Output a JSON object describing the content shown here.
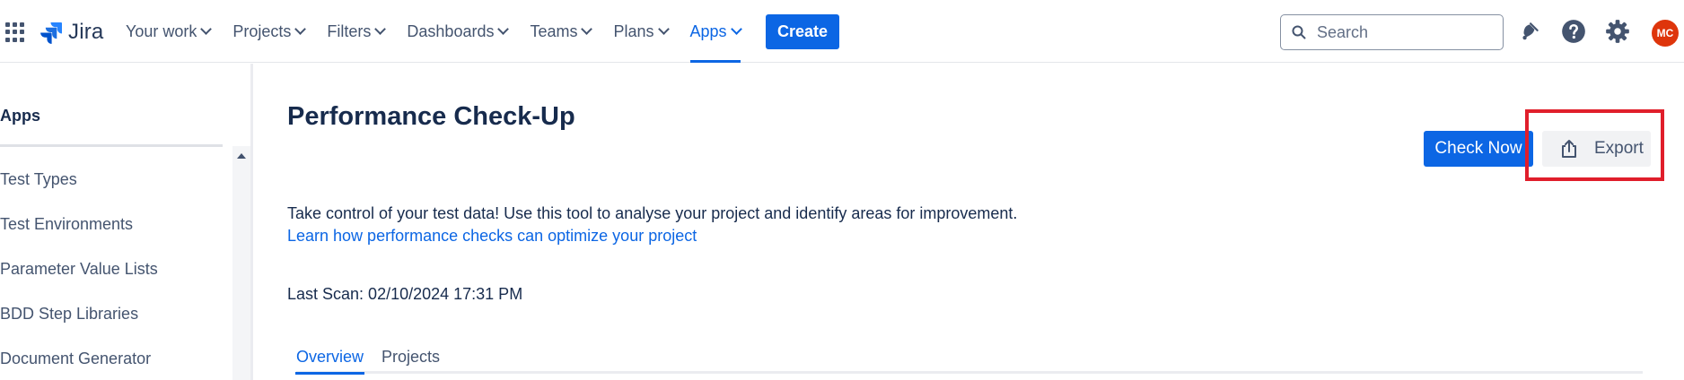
{
  "nav": {
    "logo_text": "Jira",
    "items": [
      {
        "label": "Your work"
      },
      {
        "label": "Projects"
      },
      {
        "label": "Filters"
      },
      {
        "label": "Dashboards"
      },
      {
        "label": "Teams"
      },
      {
        "label": "Plans"
      },
      {
        "label": "Apps"
      }
    ],
    "active_item": "Apps",
    "create_label": "Create",
    "search_placeholder": "Search",
    "avatar_initials": "MC",
    "accent_color": "#0c66e4",
    "icons": [
      "app-switcher-icon",
      "jira-logo-icon",
      "search-icon",
      "notifications-icon",
      "help-icon",
      "settings-icon"
    ]
  },
  "sidebar": {
    "heading": "Apps",
    "items": [
      {
        "label": "Test Types"
      },
      {
        "label": "Test Environments"
      },
      {
        "label": "Parameter Value Lists"
      },
      {
        "label": "BDD Step Libraries"
      },
      {
        "label": "Document Generator"
      }
    ]
  },
  "main": {
    "title": "Performance Check-Up",
    "check_now_label": "Check Now",
    "export_label": "Export",
    "description": "Take control of your test data! Use this tool to analyse your project and identify areas for improvement.",
    "learn_link": "Learn how performance checks can optimize your project",
    "last_scan": "Last Scan: 02/10/2024 17:31 PM",
    "tabs": [
      {
        "label": "Overview",
        "active": true
      },
      {
        "label": "Projects",
        "active": false
      }
    ],
    "highlight_color": "#e01e2b"
  }
}
